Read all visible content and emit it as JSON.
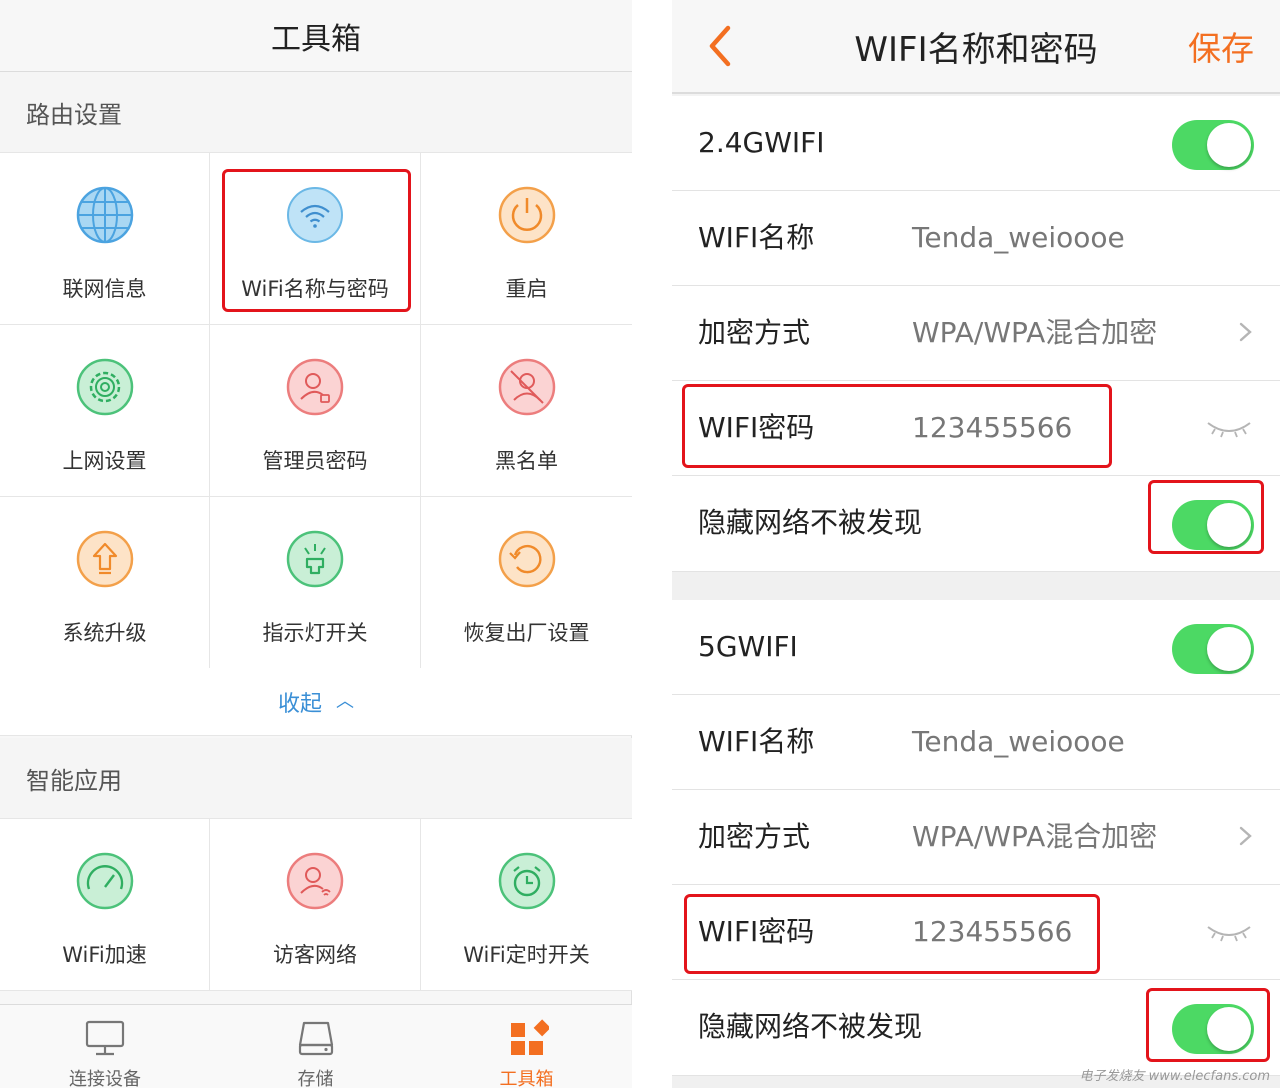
{
  "left": {
    "title": "工具箱",
    "section1": "路由设置",
    "grid1": [
      {
        "label": "联网信息",
        "icon": "globe-icon"
      },
      {
        "label": "WiFi名称与密码",
        "icon": "wifi-icon"
      },
      {
        "label": "重启",
        "icon": "power-icon"
      },
      {
        "label": "上网设置",
        "icon": "gear-icon"
      },
      {
        "label": "管理员密码",
        "icon": "admin-user-icon"
      },
      {
        "label": "黑名单",
        "icon": "blocked-user-icon"
      },
      {
        "label": "系统升级",
        "icon": "upgrade-icon"
      },
      {
        "label": "指示灯开关",
        "icon": "light-icon"
      },
      {
        "label": "恢复出厂设置",
        "icon": "restore-icon"
      }
    ],
    "collapse": "收起",
    "section2": "智能应用",
    "grid2": [
      {
        "label": "WiFi加速",
        "icon": "speedometer-icon"
      },
      {
        "label": "访客网络",
        "icon": "guest-icon"
      },
      {
        "label": "WiFi定时开关",
        "icon": "alarm-clock-icon"
      }
    ],
    "tabs": [
      {
        "label": "连接设备",
        "icon": "monitor-icon"
      },
      {
        "label": "存储",
        "icon": "storage-icon"
      },
      {
        "label": "工具箱",
        "icon": "toolbox-icon",
        "active": true
      }
    ]
  },
  "right": {
    "title": "WIFI名称和密码",
    "save": "保存",
    "band24": {
      "band": "2.4GWIFI",
      "enabled": true,
      "name_key": "WIFI名称",
      "name_val": "Tenda_weioooe",
      "enc_key": "加密方式",
      "enc_val": "WPA/WPA混合加密",
      "pwd_key": "WIFI密码",
      "pwd_val": "123455566",
      "hide_key": "隐藏网络不被发现",
      "hide_on": true
    },
    "band5": {
      "band": "5GWIFI",
      "enabled": true,
      "name_key": "WIFI名称",
      "name_val": "Tenda_weioooe",
      "enc_key": "加密方式",
      "enc_val": "WPA/WPA混合加密",
      "pwd_key": "WIFI密码",
      "pwd_val": "123455566",
      "hide_key": "隐藏网络不被发现",
      "hide_on": true
    },
    "watermark": "电子发烧友 www.elecfans.com"
  },
  "colors": {
    "accent": "#f36f21",
    "toggle_on": "#4cd964",
    "link": "#3a8fd6",
    "highlight": "#e3141b"
  }
}
